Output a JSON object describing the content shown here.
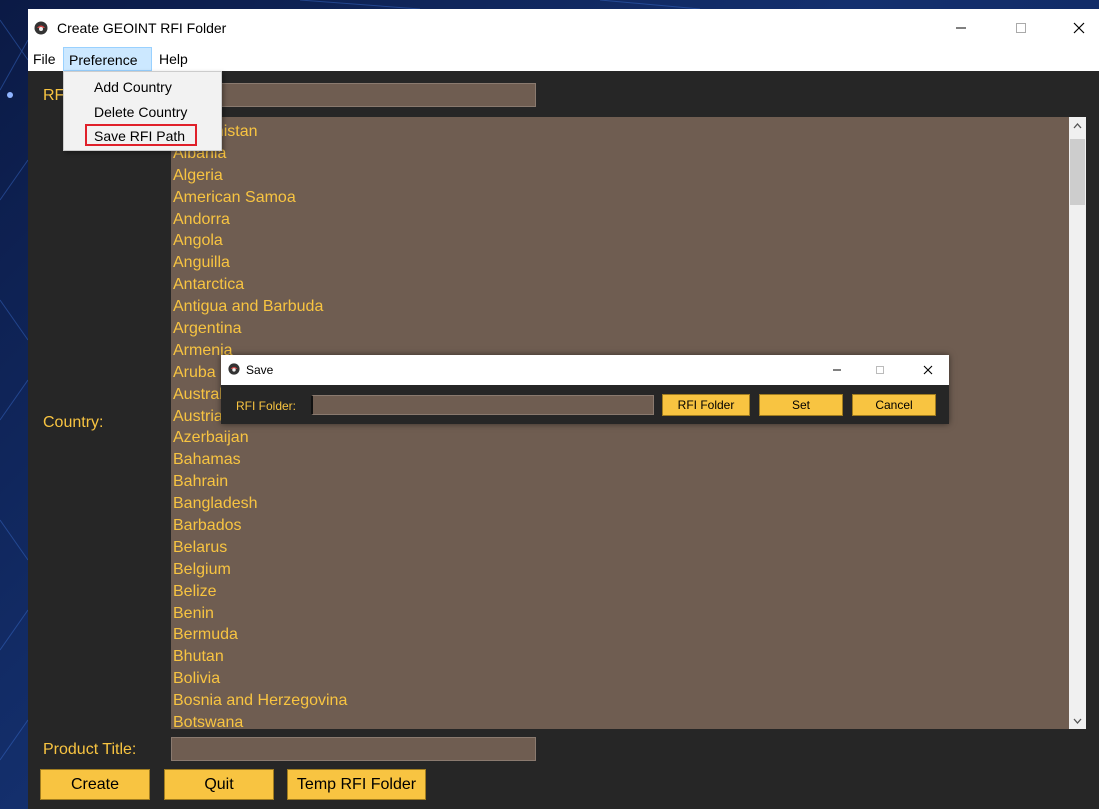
{
  "window": {
    "title": "Create GEOINT RFI Folder",
    "minimize_glyph": "─",
    "maximize_glyph": "☐",
    "close_glyph": "✕"
  },
  "menubar": {
    "file": "File",
    "preference": "Preference",
    "help": "Help"
  },
  "preference_menu": {
    "items": [
      "Add Country",
      "Delete Country",
      "Save RFI Path"
    ],
    "highlighted": "Save RFI Path"
  },
  "form": {
    "rfi_label": "RFI",
    "rfi_value": "",
    "country_label": "Country:",
    "product_title_label": "Product Title:",
    "product_title_value": ""
  },
  "countries": [
    "Afghanistan",
    "Albania",
    "Algeria",
    "American Samoa",
    "Andorra",
    "Angola",
    "Anguilla",
    "Antarctica",
    "Antigua and Barbuda",
    "Argentina",
    "Armenia",
    "Aruba",
    "Australia",
    "Austria",
    "Azerbaijan",
    "Bahamas",
    "Bahrain",
    "Bangladesh",
    "Barbados",
    "Belarus",
    "Belgium",
    "Belize",
    "Benin",
    "Bermuda",
    "Bhutan",
    "Bolivia",
    "Bosnia and Herzegovina",
    "Botswana"
  ],
  "buttons": {
    "create": "Create",
    "quit": "Quit",
    "temp_rfi_folder": "Temp RFI Folder"
  },
  "save_dialog": {
    "title": "Save",
    "rfi_folder_label": "RFI Folder:",
    "rfi_folder_value": "",
    "rfi_folder_button": "RFI Folder",
    "set_button": "Set",
    "cancel_button": "Cancel"
  },
  "colors": {
    "accent": "#f8c441",
    "list_background": "#6f5d51",
    "window_background": "#262626",
    "menu_highlight_border": "#e0202a"
  }
}
